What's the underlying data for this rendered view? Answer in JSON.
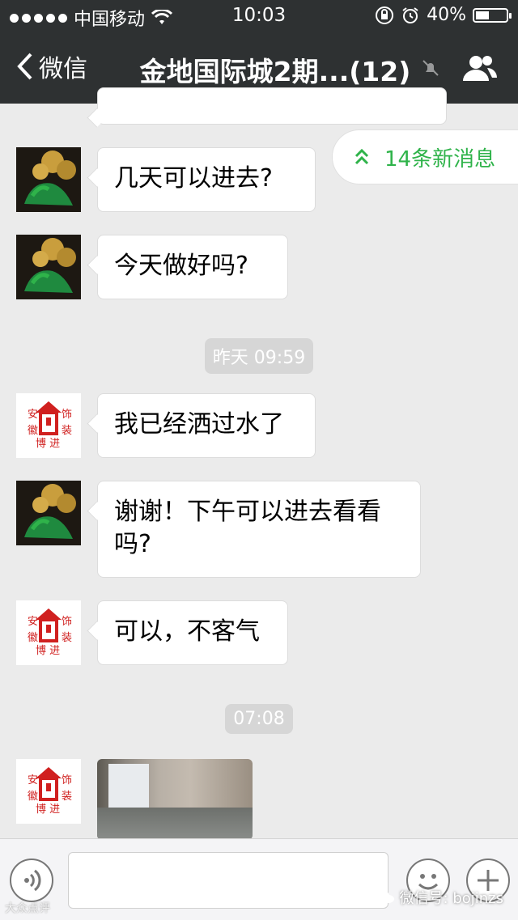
{
  "status_bar": {
    "carrier": "中国移动",
    "time": "10:03",
    "battery": "40%"
  },
  "nav": {
    "back_label": "微信",
    "title": "金地国际城2期...(12)"
  },
  "new_messages": "14条新消息",
  "messages": [
    {
      "sender": "horse",
      "text": "几天可以进去?"
    },
    {
      "sender": "horse",
      "text": "今天做好吗?"
    },
    {
      "sender": "logo",
      "text": "我已经洒过水了"
    },
    {
      "sender": "horse",
      "text": "谢谢！下午可以进去看看吗?"
    },
    {
      "sender": "logo",
      "text": "可以，不客气"
    }
  ],
  "timestamps": [
    "昨天 09:59",
    "07:08"
  ],
  "logo_text": {
    "top_left": "安",
    "top_right": "饰",
    "bottom_left": "徽",
    "bottom_right": "装",
    "center_bottom": "博 进"
  },
  "watermark_left": "大众点评",
  "watermark_right": "微信号: bojinzs",
  "colors": {
    "nav_bg": "#2e3132",
    "accent_green": "#2fb34a",
    "logo_red": "#d0201f"
  }
}
